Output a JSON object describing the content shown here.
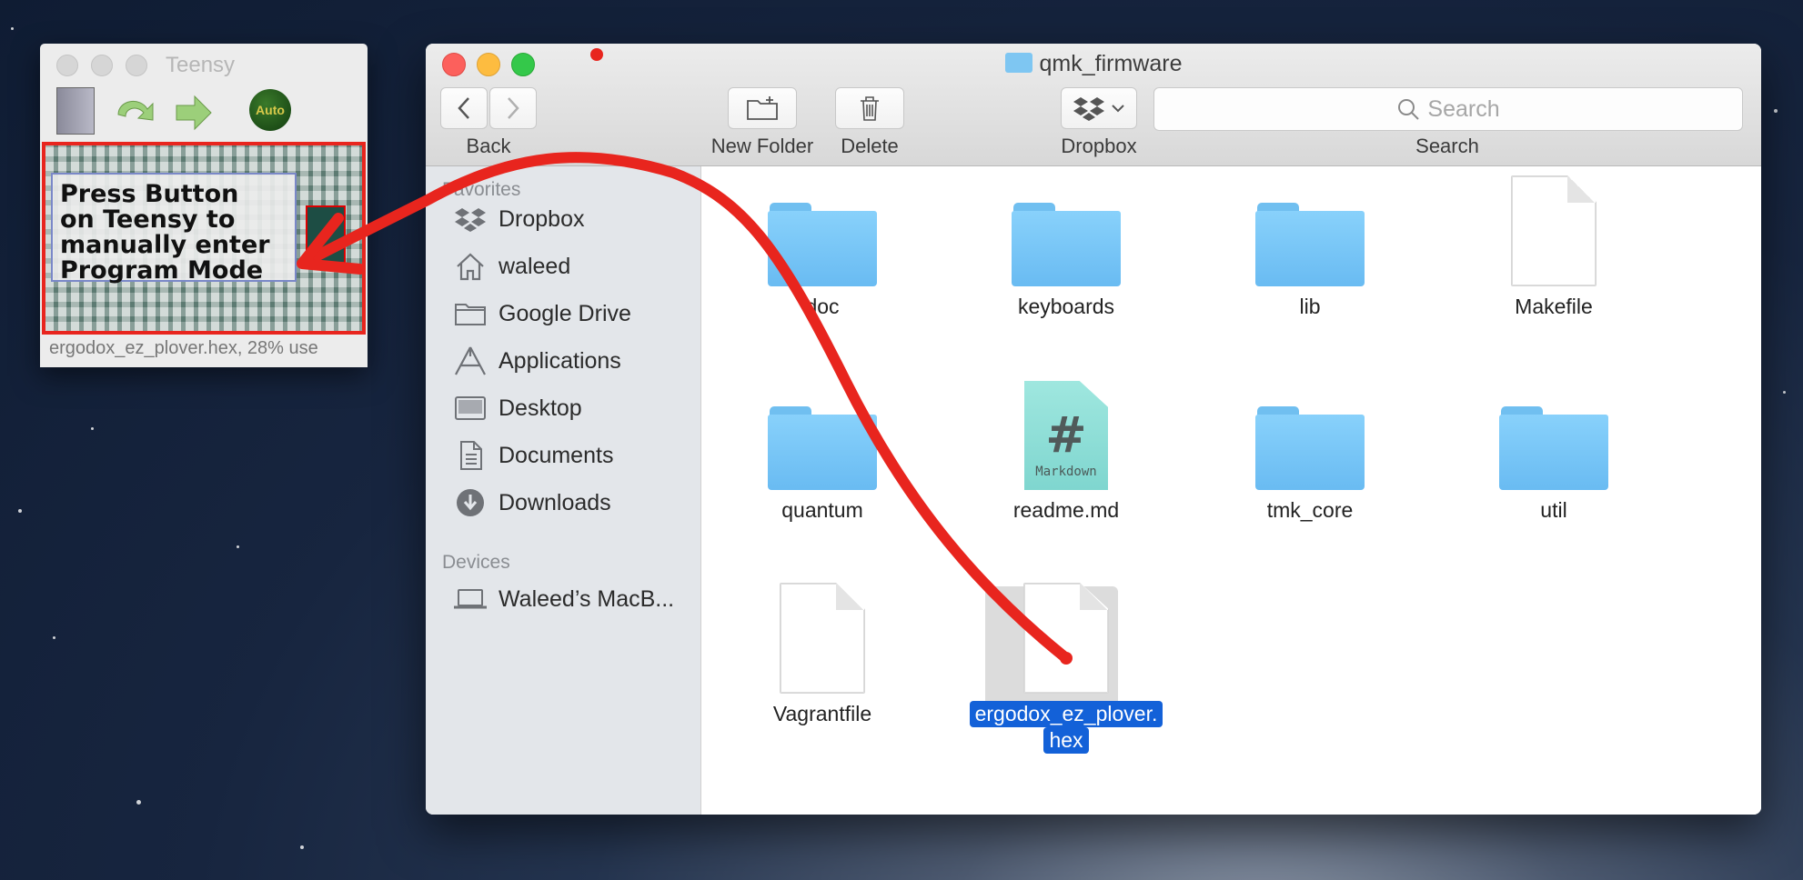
{
  "teensy": {
    "title": "Teensy",
    "auto_label": "Auto",
    "callout_text": "Press Button\non Teensy to\nmanually enter\nProgram Mode",
    "status": "ergodox_ez_plover.hex, 28% use"
  },
  "finder": {
    "window_title": "qmk_firmware",
    "toolbar": {
      "back_label": "Back",
      "new_folder_label": "New Folder",
      "delete_label": "Delete",
      "dropbox_label": "Dropbox",
      "search_label": "Search",
      "search_placeholder": "Search"
    },
    "sidebar": {
      "favorites_header": "Favorites",
      "favorites": [
        {
          "label": "Dropbox",
          "icon": "dropbox-icon"
        },
        {
          "label": "waleed",
          "icon": "home-icon"
        },
        {
          "label": "Google Drive",
          "icon": "folder-icon"
        },
        {
          "label": "Applications",
          "icon": "applications-icon"
        },
        {
          "label": "Desktop",
          "icon": "desktop-icon"
        },
        {
          "label": "Documents",
          "icon": "documents-icon"
        },
        {
          "label": "Downloads",
          "icon": "downloads-icon"
        }
      ],
      "devices_header": "Devices",
      "devices": [
        {
          "label": "Waleed’s MacB...",
          "icon": "laptop-icon"
        }
      ]
    },
    "files": [
      {
        "name": "doc",
        "kind": "folder"
      },
      {
        "name": "keyboards",
        "kind": "folder"
      },
      {
        "name": "lib",
        "kind": "folder"
      },
      {
        "name": "Makefile",
        "kind": "document"
      },
      {
        "name": "quantum",
        "kind": "folder"
      },
      {
        "name": "readme.md",
        "kind": "markdown",
        "badge": "#",
        "badge_label": "Markdown"
      },
      {
        "name": "tmk_core",
        "kind": "folder"
      },
      {
        "name": "util",
        "kind": "folder"
      },
      {
        "name": "Vagrantfile",
        "kind": "document"
      },
      {
        "name": "ergodox_ez_plover.",
        "name_line2": "hex",
        "kind": "document",
        "selected": true
      }
    ]
  },
  "colors": {
    "annotation_red": "#e8251e",
    "selection_blue": "#1361d8",
    "folder_blue": "#7ec6f2"
  }
}
